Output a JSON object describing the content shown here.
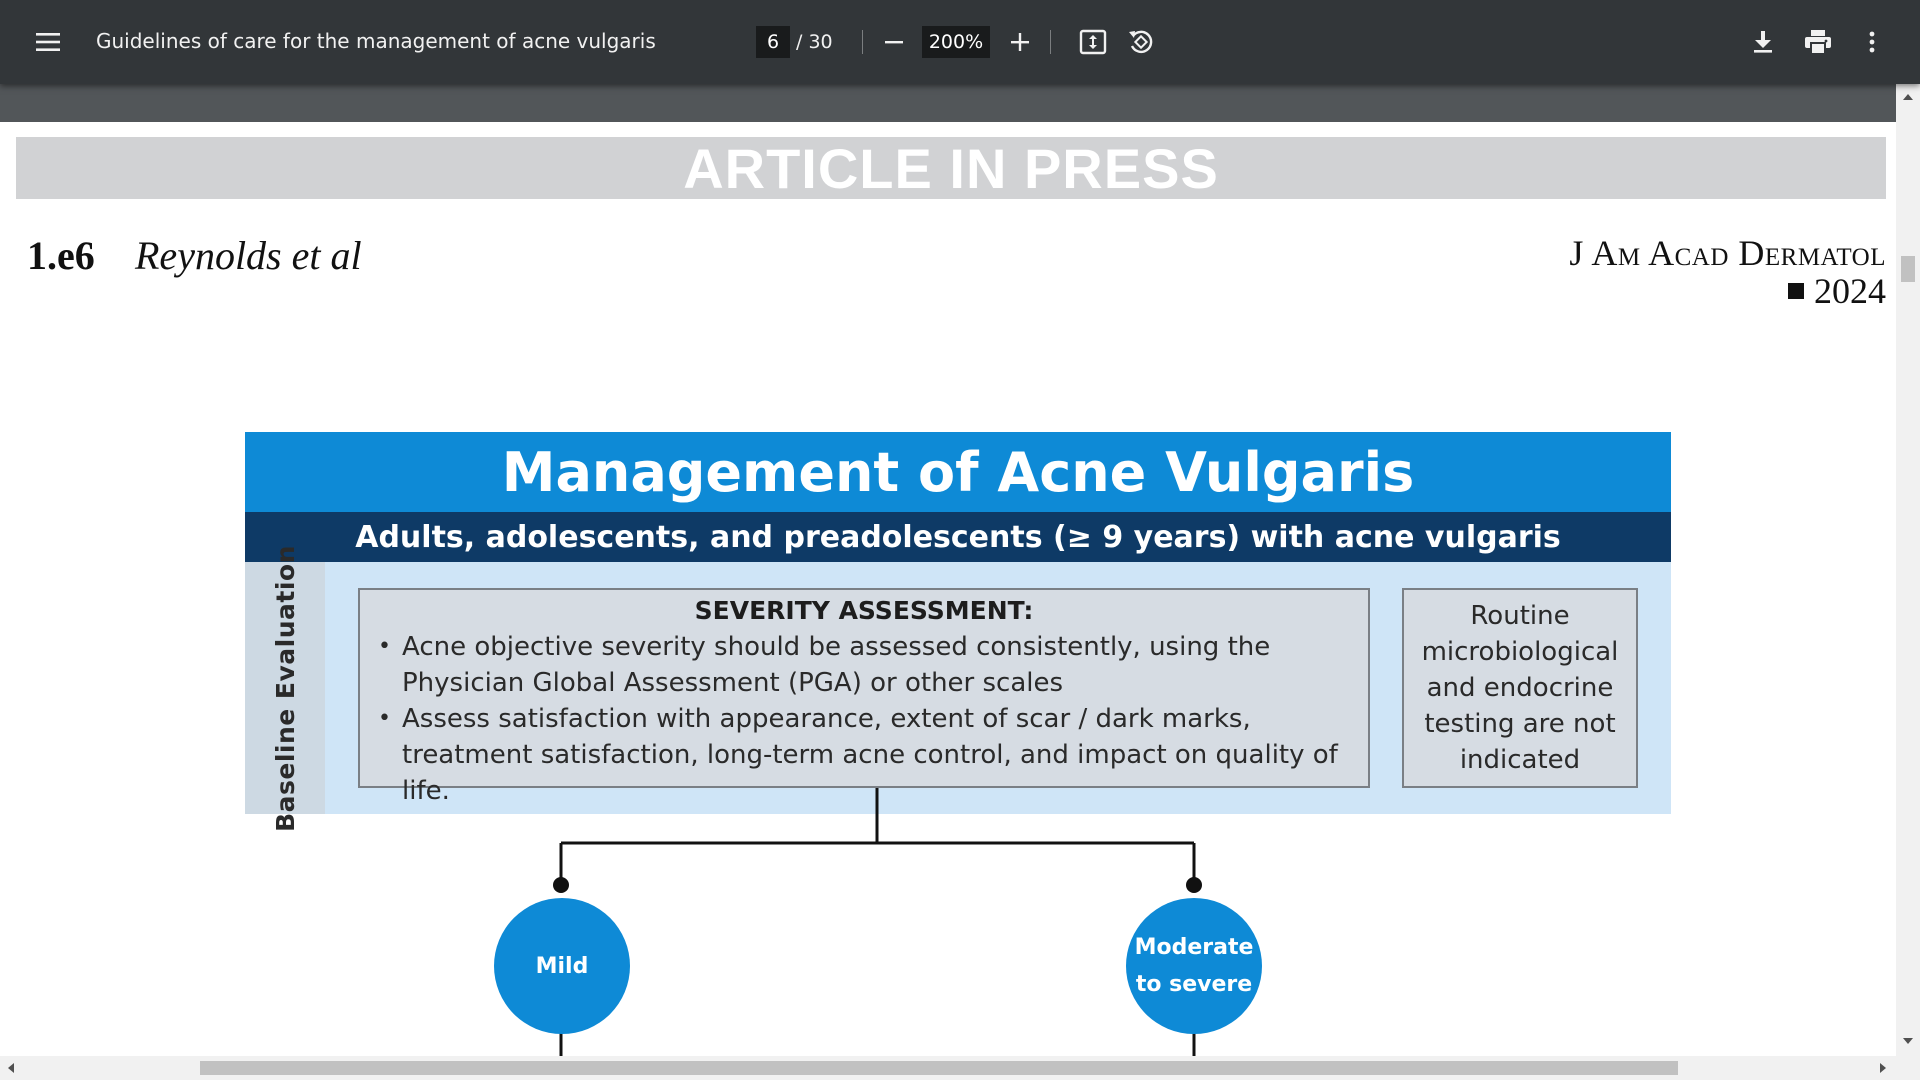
{
  "toolbar": {
    "menu_icon": "hamburger-menu-icon",
    "title": "Guidelines of care for the management of acne vulgaris",
    "page_current": "6",
    "page_total": "/ 30",
    "zoom_out_icon": "minus-icon",
    "zoom_value": "200%",
    "zoom_in_icon": "plus-icon",
    "fit_icon": "fit-to-page-icon",
    "rotate_icon": "rotate-counterclockwise-icon",
    "download_icon": "download-icon",
    "print_icon": "print-icon",
    "more_icon": "more-vertical-icon"
  },
  "page": {
    "banner": "ARTICLE IN PRESS",
    "page_number": "1.e6",
    "authors": "Reynolds et al",
    "journal": "J Am Acad Dermatol",
    "year": "2024"
  },
  "flowchart": {
    "title": "Management of Acne Vulgaris",
    "subtitle": "Adults, adolescents, and preadolescents (≥ 9 years) with acne vulgaris",
    "side_label": "Baseline  Evaluation",
    "severity": {
      "heading": "SEVERITY ASSESSMENT:",
      "bullets": [
        "Acne objective severity should be assessed consistently, using the Physician Global Assessment (PGA) or other scales",
        "Assess satisfaction with appearance, extent of scar / dark marks, treatment satisfaction, long-term acne control, and impact on quality of life."
      ]
    },
    "routine": "Routine microbiological and endocrine testing are not indicated",
    "nodes": {
      "mild": "Mild",
      "moderate_line1": "Moderate",
      "moderate_line2": "to severe"
    }
  },
  "colors": {
    "toolbar_bg": "#323639",
    "viewer_bg": "#525659",
    "title_blue": "#0e8ad6",
    "navy": "#0e3a66",
    "band_light_blue": "#cfe5f7",
    "box_gray": "#d6dce3"
  }
}
